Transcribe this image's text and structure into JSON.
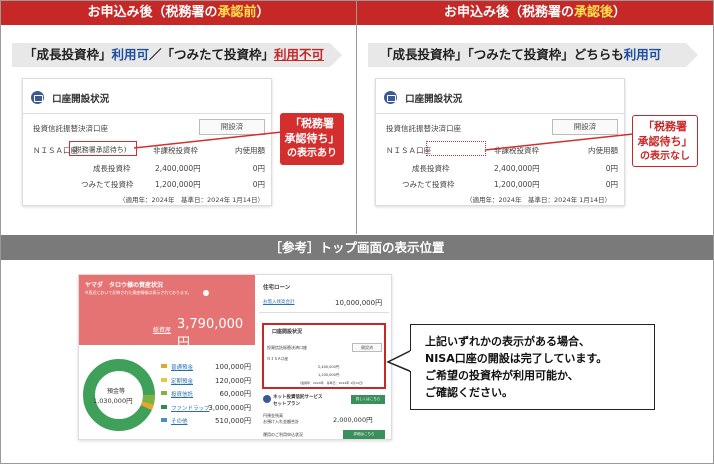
{
  "left": {
    "header_pre": "お申込み後（税務署の",
    "header_hl": "承認前",
    "header_post": "）",
    "banner_a": "「成長投資枠」",
    "banner_b": "利用可",
    "banner_c": "／「つみたて投資枠」",
    "banner_d": "利用不可"
  },
  "right": {
    "header_pre": "お申込み後（税務署の",
    "header_hl": "承認後",
    "header_post": "）",
    "banner_a": "「成長投資枠」「つみたて投資枠」どちらも",
    "banner_b": "利用可"
  },
  "card": {
    "title": "口座開設状況",
    "row1_label": "投資信託振替決済口座",
    "row1_btn": "開設済",
    "nisa_label": "ＮＩＳＡ口座",
    "nisa_status": "(税務署承認待ち)",
    "col_limit": "非課税投資枠",
    "col_used": "内使用額",
    "growth_label": "成長投資枠",
    "growth_value": "2,400,000円",
    "growth_used": "0円",
    "tsumitate_label": "つみたて投資枠",
    "tsumitate_value": "1,200,000円",
    "tsumitate_used": "0円",
    "footnote": "（適用年：2024年　基準日：2024年 1月14日）"
  },
  "callout_left": [
    "「税務署",
    "承認待ち」",
    "の表示あり"
  ],
  "callout_right": [
    "「税務署",
    "承認待ち」",
    "の表示なし"
  ],
  "ref_banner": "［参考］トップ画面の表示位置",
  "top": {
    "user": "ヤマダ　タロウ様の資産状況",
    "note": "※直近において反映された資産情報は表示されております。",
    "total_label": "総資産",
    "total_value": "3,790,000円",
    "donut_label": "預金等",
    "donut_value": "1,030,000円",
    "legend": [
      {
        "name": "普通預金",
        "value": "100,000円",
        "color": "#e6a532"
      },
      {
        "name": "定期預金",
        "value": "120,000円",
        "color": "#e8c547"
      },
      {
        "name": "投資信託",
        "value": "60,000円",
        "color": "#7cb342"
      },
      {
        "name": "ファンドラップ",
        "value": "3,000,000円",
        "color": "#2e8b57"
      },
      {
        "name": "その他",
        "value": "510,000円",
        "color": "#4a90c9"
      }
    ],
    "loan_title": "住宅ローン",
    "loan_sub": "お借入残高合計",
    "loan_value": "10,000,000円",
    "acct_title": "口座開設状況",
    "acct_btn": "開設済",
    "net_title": "ネット投資信託サービス",
    "net_sub": "セットプラン",
    "net_btn": "詳しくはこちら",
    "net_row1a": "円預金残高",
    "net_row1b": "お預け入れ金額合計",
    "net_value": "2,000,000円",
    "net_row2": "運用のご利用申込状況",
    "net_btn2": "詳細はこちら"
  },
  "message": [
    "上記いずれかの表示がある場合、",
    "NISA口座の開設は完了しています。",
    "ご希望の投資枠が利用可能か、",
    "ご確認ください。"
  ],
  "colors": {
    "red": "#c62828",
    "blue": "#1f4e9e",
    "yellow": "#ffe14d",
    "salmon": "#e57373"
  }
}
